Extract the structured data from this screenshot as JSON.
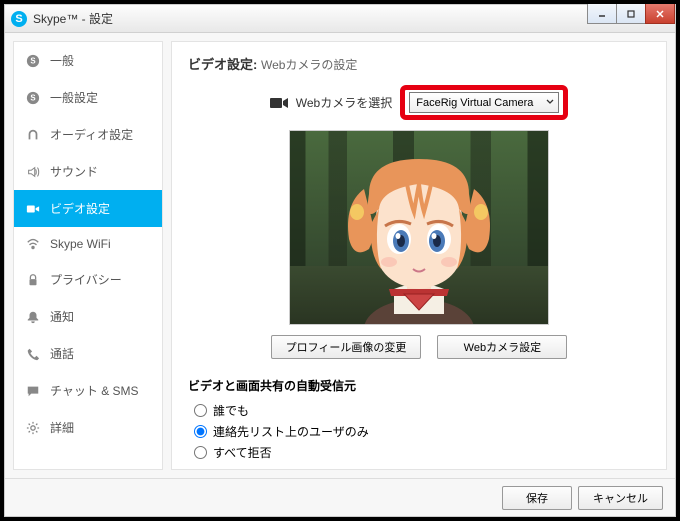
{
  "window": {
    "title": "Skype™ - 設定"
  },
  "sidebar": {
    "items": [
      {
        "label": "一般",
        "icon": "skype"
      },
      {
        "label": "一般設定",
        "icon": "skype"
      },
      {
        "label": "オーディオ設定",
        "icon": "headset"
      },
      {
        "label": "サウンド",
        "icon": "sound"
      },
      {
        "label": "ビデオ設定",
        "icon": "video"
      },
      {
        "label": "Skype WiFi",
        "icon": "wifi"
      },
      {
        "label": "プライバシー",
        "icon": "lock"
      },
      {
        "label": "通知",
        "icon": "bell"
      },
      {
        "label": "通話",
        "icon": "phone"
      },
      {
        "label": "チャット & SMS",
        "icon": "chat"
      },
      {
        "label": "詳細",
        "icon": "gear"
      }
    ]
  },
  "main": {
    "heading": "ビデオ設定:",
    "sub_heading": "Webカメラの設定",
    "camera_label": "Webカメラを選択",
    "camera_selected": "FaceRig Virtual Camera",
    "profile_button": "プロフィール画像の変更",
    "settings_button": "Webカメラ設定",
    "auto_accept": {
      "title": "ビデオと画面共有の自動受信元",
      "options": [
        {
          "label": "誰でも"
        },
        {
          "label": "連絡先リスト上のユーザのみ"
        },
        {
          "label": "すべて拒否"
        }
      ],
      "selected_index": 1
    }
  },
  "footer": {
    "save": "保存",
    "cancel": "キャンセル"
  }
}
